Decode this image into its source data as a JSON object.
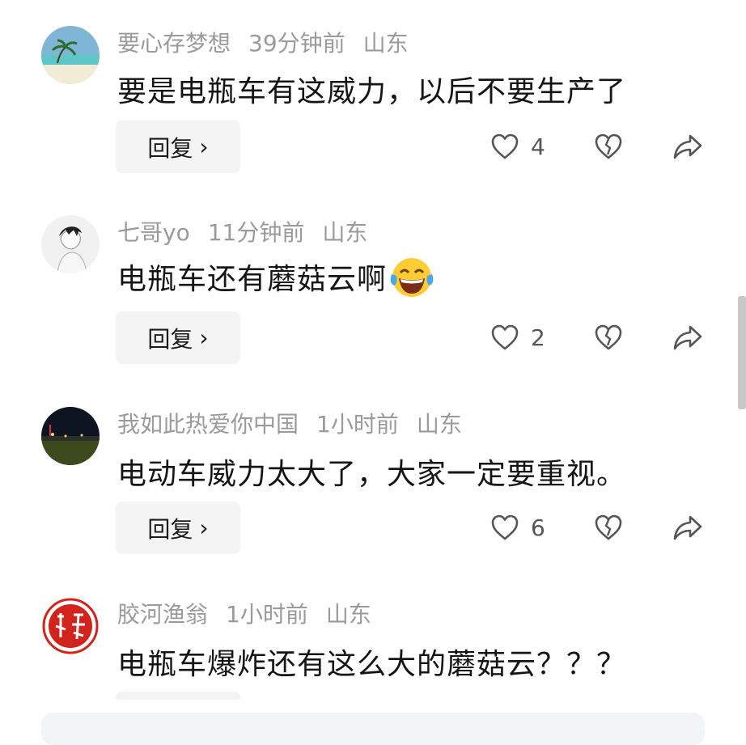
{
  "comments": [
    {
      "username": "要心存梦想",
      "time": "39分钟前",
      "location": "山东",
      "text": "要是电瓶车有这威力，以后不要生产了",
      "reply_label": "回复",
      "likes": "4",
      "avatar": "beach-avatar"
    },
    {
      "username": "七哥yo",
      "time": "11分钟前",
      "location": "山东",
      "text": "电瓶车还有蘑菇云啊",
      "emoji": "laughing-tears-emoji",
      "reply_label": "回复",
      "likes": "2",
      "avatar": "sketch-avatar"
    },
    {
      "username": "我如此热爱你中国",
      "time": "1小时前",
      "location": "山东",
      "text": "电动车威力太大了，大家一定要重视。",
      "reply_label": "回复",
      "likes": "6",
      "avatar": "night-field-avatar"
    },
    {
      "username": "胶河渔翁",
      "time": "1小时前",
      "location": "山东",
      "text": "电瓶车爆炸还有这么大的蘑菇云？？？",
      "avatar": "red-seal-avatar"
    }
  ],
  "icons": {
    "reply_chevron": "chevron-right-icon",
    "like": "heart-outline-icon",
    "dislike": "broken-heart-icon",
    "share": "share-arrow-icon"
  },
  "colors": {
    "meta_text": "#9a9a9a",
    "button_bg": "#f4f4f4",
    "seal_red": "#d0241c"
  }
}
